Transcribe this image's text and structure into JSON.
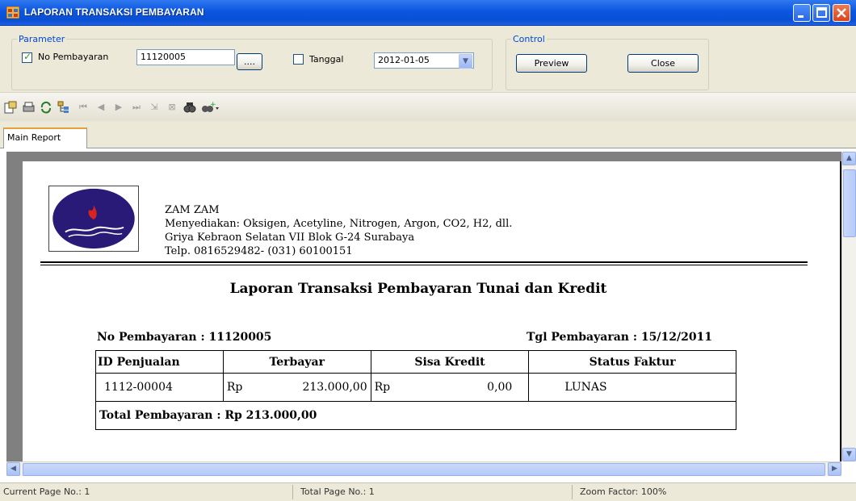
{
  "window": {
    "title": "LAPORAN TRANSAKSI PEMBAYARAN"
  },
  "parameter": {
    "legend": "Parameter",
    "no_pembayaran_label": "No Pembayaran",
    "no_pembayaran_checked": true,
    "no_pembayaran_value": "11120005",
    "browse_label": "....",
    "tanggal_label": "Tanggal",
    "tanggal_checked": false,
    "tanggal_value": "2012-01-05"
  },
  "control": {
    "legend": "Control",
    "preview_label": "Preview",
    "close_label": "Close"
  },
  "toolbar": {
    "icons": [
      "export-icon",
      "print-icon",
      "refresh-icon",
      "group-tree-icon",
      "first-page-icon",
      "prev-page-icon",
      "next-page-icon",
      "last-page-icon",
      "goto-page-icon",
      "stop-icon",
      "find-icon",
      "zoom-icon"
    ]
  },
  "tabs": [
    {
      "label": "Main Report"
    }
  ],
  "report": {
    "company": {
      "name": "ZAM ZAM",
      "products": "Menyediakan: Oksigen, Acetyline, Nitrogen, Argon, CO2, H2, dll.",
      "address": "Griya Kebraon Selatan VII Blok G-24 Surabaya",
      "phone": "Telp. 0816529482- (031) 60100151"
    },
    "title": "Laporan Transaksi Pembayaran Tunai dan Kredit",
    "no_pembayaran": "No Pembayaran : 11120005",
    "tgl_pembayaran": "Tgl Pembayaran : 15/12/2011",
    "table": {
      "headers": [
        "ID Penjualan",
        "Terbayar",
        "Sisa Kredit",
        "Status Faktur"
      ],
      "rows": [
        {
          "id": "1112-00004",
          "terbayar_cur": "Rp",
          "terbayar": "213.000,00",
          "sisa_cur": "Rp",
          "sisa": "0,00",
          "status": "LUNAS"
        }
      ],
      "total": "Total Pembayaran : Rp 213.000,00"
    }
  },
  "statusbar": {
    "current_page": "Current Page No.: 1",
    "total_page": "Total Page No.: 1",
    "zoom": "Zoom Factor: 100%"
  },
  "colors": {
    "titlebar": "#0b56e0",
    "accent": "#0046d5",
    "logo_bg": "#2a1a78",
    "flame": "#d8231f"
  }
}
